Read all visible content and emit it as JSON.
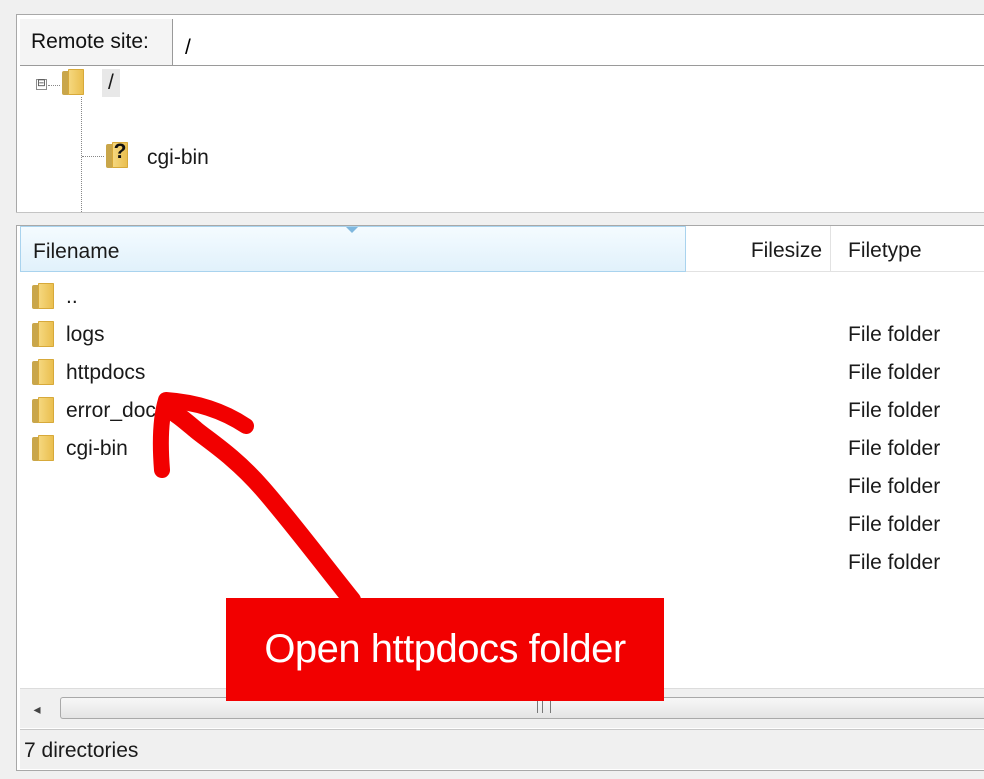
{
  "remote_site": {
    "label": "Remote site:",
    "path": "/"
  },
  "tree": {
    "root_label": "/",
    "toggle_symbol": "⊟",
    "unknown_icon_symbol": "?",
    "children": [
      {
        "label": "cgi-bin"
      }
    ]
  },
  "file_list": {
    "columns": {
      "filename": "Filename",
      "filesize": "Filesize",
      "filetype": "Filetype"
    },
    "rows": [
      {
        "name": "..",
        "type": ""
      },
      {
        "name": "logs",
        "type": "File folder"
      },
      {
        "name": "httpdocs",
        "type": "File folder"
      },
      {
        "name": "error_docs",
        "type": "File folder"
      },
      {
        "name": "cgi-bin",
        "type": "File folder"
      },
      {
        "name": "",
        "type": "File folder"
      },
      {
        "name": "",
        "type": "File folder"
      },
      {
        "name": "",
        "type": "File folder"
      }
    ]
  },
  "scrollbar": {
    "left_arrow": "◂"
  },
  "status": {
    "text": "7 directories"
  },
  "annotation": {
    "callout_text": "Open httpdocs folder",
    "color": "#f20000"
  },
  "colors": {
    "header_highlight": "#e1f1fb",
    "folder": "#e9bd4c"
  }
}
